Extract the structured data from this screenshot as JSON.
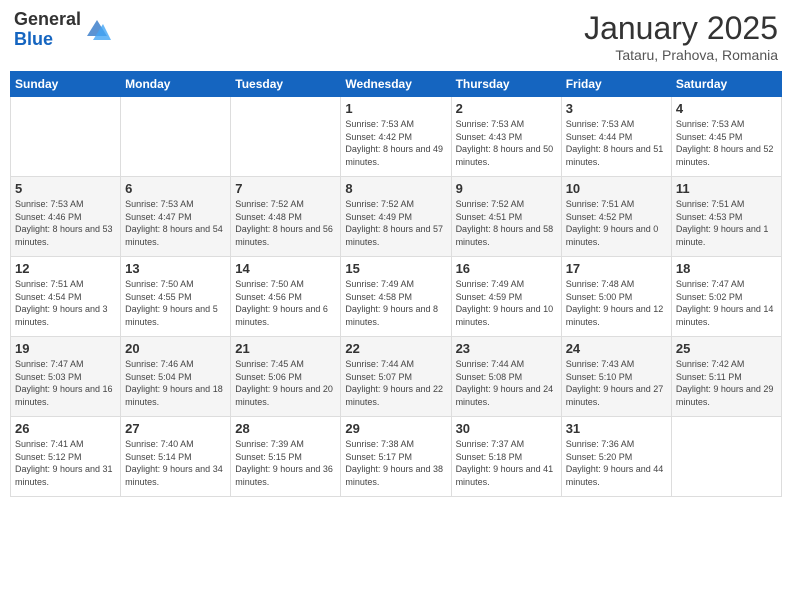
{
  "header": {
    "logo_line1": "General",
    "logo_line2": "Blue",
    "title": "January 2025",
    "subtitle": "Tataru, Prahova, Romania"
  },
  "weekdays": [
    "Sunday",
    "Monday",
    "Tuesday",
    "Wednesday",
    "Thursday",
    "Friday",
    "Saturday"
  ],
  "weeks": [
    [
      {
        "day": "",
        "info": ""
      },
      {
        "day": "",
        "info": ""
      },
      {
        "day": "",
        "info": ""
      },
      {
        "day": "1",
        "info": "Sunrise: 7:53 AM\nSunset: 4:42 PM\nDaylight: 8 hours\nand 49 minutes."
      },
      {
        "day": "2",
        "info": "Sunrise: 7:53 AM\nSunset: 4:43 PM\nDaylight: 8 hours\nand 50 minutes."
      },
      {
        "day": "3",
        "info": "Sunrise: 7:53 AM\nSunset: 4:44 PM\nDaylight: 8 hours\nand 51 minutes."
      },
      {
        "day": "4",
        "info": "Sunrise: 7:53 AM\nSunset: 4:45 PM\nDaylight: 8 hours\nand 52 minutes."
      }
    ],
    [
      {
        "day": "5",
        "info": "Sunrise: 7:53 AM\nSunset: 4:46 PM\nDaylight: 8 hours\nand 53 minutes."
      },
      {
        "day": "6",
        "info": "Sunrise: 7:53 AM\nSunset: 4:47 PM\nDaylight: 8 hours\nand 54 minutes."
      },
      {
        "day": "7",
        "info": "Sunrise: 7:52 AM\nSunset: 4:48 PM\nDaylight: 8 hours\nand 56 minutes."
      },
      {
        "day": "8",
        "info": "Sunrise: 7:52 AM\nSunset: 4:49 PM\nDaylight: 8 hours\nand 57 minutes."
      },
      {
        "day": "9",
        "info": "Sunrise: 7:52 AM\nSunset: 4:51 PM\nDaylight: 8 hours\nand 58 minutes."
      },
      {
        "day": "10",
        "info": "Sunrise: 7:51 AM\nSunset: 4:52 PM\nDaylight: 9 hours\nand 0 minutes."
      },
      {
        "day": "11",
        "info": "Sunrise: 7:51 AM\nSunset: 4:53 PM\nDaylight: 9 hours\nand 1 minute."
      }
    ],
    [
      {
        "day": "12",
        "info": "Sunrise: 7:51 AM\nSunset: 4:54 PM\nDaylight: 9 hours\nand 3 minutes."
      },
      {
        "day": "13",
        "info": "Sunrise: 7:50 AM\nSunset: 4:55 PM\nDaylight: 9 hours\nand 5 minutes."
      },
      {
        "day": "14",
        "info": "Sunrise: 7:50 AM\nSunset: 4:56 PM\nDaylight: 9 hours\nand 6 minutes."
      },
      {
        "day": "15",
        "info": "Sunrise: 7:49 AM\nSunset: 4:58 PM\nDaylight: 9 hours\nand 8 minutes."
      },
      {
        "day": "16",
        "info": "Sunrise: 7:49 AM\nSunset: 4:59 PM\nDaylight: 9 hours\nand 10 minutes."
      },
      {
        "day": "17",
        "info": "Sunrise: 7:48 AM\nSunset: 5:00 PM\nDaylight: 9 hours\nand 12 minutes."
      },
      {
        "day": "18",
        "info": "Sunrise: 7:47 AM\nSunset: 5:02 PM\nDaylight: 9 hours\nand 14 minutes."
      }
    ],
    [
      {
        "day": "19",
        "info": "Sunrise: 7:47 AM\nSunset: 5:03 PM\nDaylight: 9 hours\nand 16 minutes."
      },
      {
        "day": "20",
        "info": "Sunrise: 7:46 AM\nSunset: 5:04 PM\nDaylight: 9 hours\nand 18 minutes."
      },
      {
        "day": "21",
        "info": "Sunrise: 7:45 AM\nSunset: 5:06 PM\nDaylight: 9 hours\nand 20 minutes."
      },
      {
        "day": "22",
        "info": "Sunrise: 7:44 AM\nSunset: 5:07 PM\nDaylight: 9 hours\nand 22 minutes."
      },
      {
        "day": "23",
        "info": "Sunrise: 7:44 AM\nSunset: 5:08 PM\nDaylight: 9 hours\nand 24 minutes."
      },
      {
        "day": "24",
        "info": "Sunrise: 7:43 AM\nSunset: 5:10 PM\nDaylight: 9 hours\nand 27 minutes."
      },
      {
        "day": "25",
        "info": "Sunrise: 7:42 AM\nSunset: 5:11 PM\nDaylight: 9 hours\nand 29 minutes."
      }
    ],
    [
      {
        "day": "26",
        "info": "Sunrise: 7:41 AM\nSunset: 5:12 PM\nDaylight: 9 hours\nand 31 minutes."
      },
      {
        "day": "27",
        "info": "Sunrise: 7:40 AM\nSunset: 5:14 PM\nDaylight: 9 hours\nand 34 minutes."
      },
      {
        "day": "28",
        "info": "Sunrise: 7:39 AM\nSunset: 5:15 PM\nDaylight: 9 hours\nand 36 minutes."
      },
      {
        "day": "29",
        "info": "Sunrise: 7:38 AM\nSunset: 5:17 PM\nDaylight: 9 hours\nand 38 minutes."
      },
      {
        "day": "30",
        "info": "Sunrise: 7:37 AM\nSunset: 5:18 PM\nDaylight: 9 hours\nand 41 minutes."
      },
      {
        "day": "31",
        "info": "Sunrise: 7:36 AM\nSunset: 5:20 PM\nDaylight: 9 hours\nand 44 minutes."
      },
      {
        "day": "",
        "info": ""
      }
    ]
  ]
}
